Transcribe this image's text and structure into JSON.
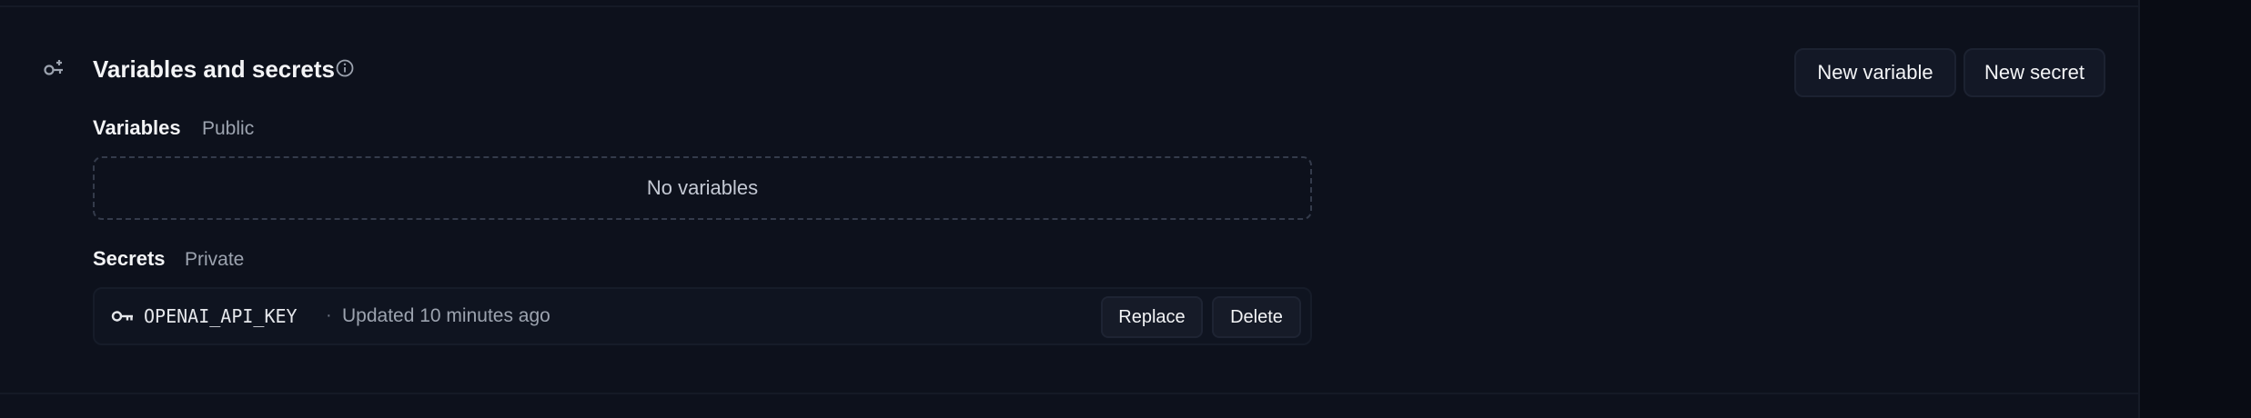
{
  "section": {
    "title": "Variables and secrets",
    "icon": "key-settings-icon",
    "info_icon": "info-icon"
  },
  "actions": {
    "new_variable_label": "New variable",
    "new_secret_label": "New secret"
  },
  "variables": {
    "heading": "Variables",
    "visibility": "Public",
    "empty_text": "No variables",
    "items": []
  },
  "secrets": {
    "heading": "Secrets",
    "visibility": "Private",
    "items": [
      {
        "icon": "key-icon",
        "name": "OPENAI_API_KEY",
        "separator": "·",
        "updated": "Updated 10 minutes ago",
        "replace_label": "Replace",
        "delete_label": "Delete"
      }
    ]
  },
  "colors": {
    "background": "#0b0f19",
    "panel": "#0d111c",
    "text_primary": "#f3f4f6",
    "text_secondary": "#9ca3af",
    "button_bg": "#131826",
    "dashed_border": "#343b4b"
  }
}
